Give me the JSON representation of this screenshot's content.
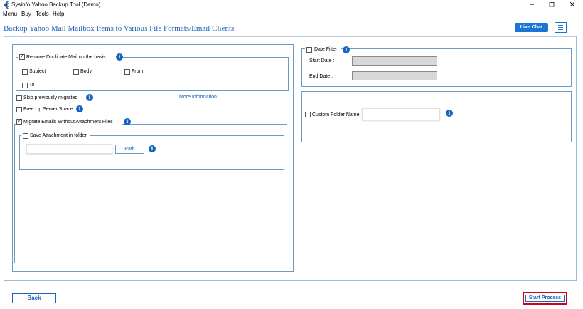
{
  "window": {
    "title": "Sysinfo Yahoo Backup Tool (Demo)",
    "minimize_icon": "minimize-icon",
    "maximize_icon": "maximize-icon",
    "close_icon": "close-icon"
  },
  "menubar": {
    "items": [
      "Menu",
      "Buy",
      "Tools",
      "Help"
    ]
  },
  "header": {
    "title": "Backup Yahoo Mail Mailbox Items to Various File Formats/Email Clients",
    "live_chat_label": "Live Chat",
    "menu_icon": "hamburger-icon"
  },
  "left": {
    "remove_duplicates": {
      "label": "Remove Duplicate Mail on the basis",
      "checked": true,
      "options": [
        {
          "label": "Subject",
          "checked": false
        },
        {
          "label": "Body",
          "checked": false
        },
        {
          "label": "From",
          "checked": false
        },
        {
          "label": "To",
          "checked": false
        }
      ]
    },
    "skip_migrated": {
      "label": "Skip previously migrated",
      "checked": false
    },
    "more_information": "More Information",
    "free_up_space": {
      "label": "Free Up Server Space",
      "checked": false
    },
    "migrate_without_attachments": {
      "label": "Migrate Emails Without Attachment Files",
      "checked": true
    },
    "save_attachment": {
      "label": "Save Attachment in folder",
      "checked": false,
      "path_value": "",
      "path_button": "Path"
    }
  },
  "right": {
    "date_filter": {
      "label": "Date Filter",
      "checked": false,
      "start_label": "Start Date :",
      "start_value": "",
      "end_label": "End Date :",
      "end_value": ""
    },
    "custom_folder": {
      "label": "Custom Folder Name",
      "checked": false,
      "value": ""
    }
  },
  "footer": {
    "back_label": "Back",
    "start_label": "Start Process"
  },
  "colors": {
    "accent": "#1976d2",
    "title_blue": "#1a63b9",
    "highlight_red": "#d0021b"
  }
}
